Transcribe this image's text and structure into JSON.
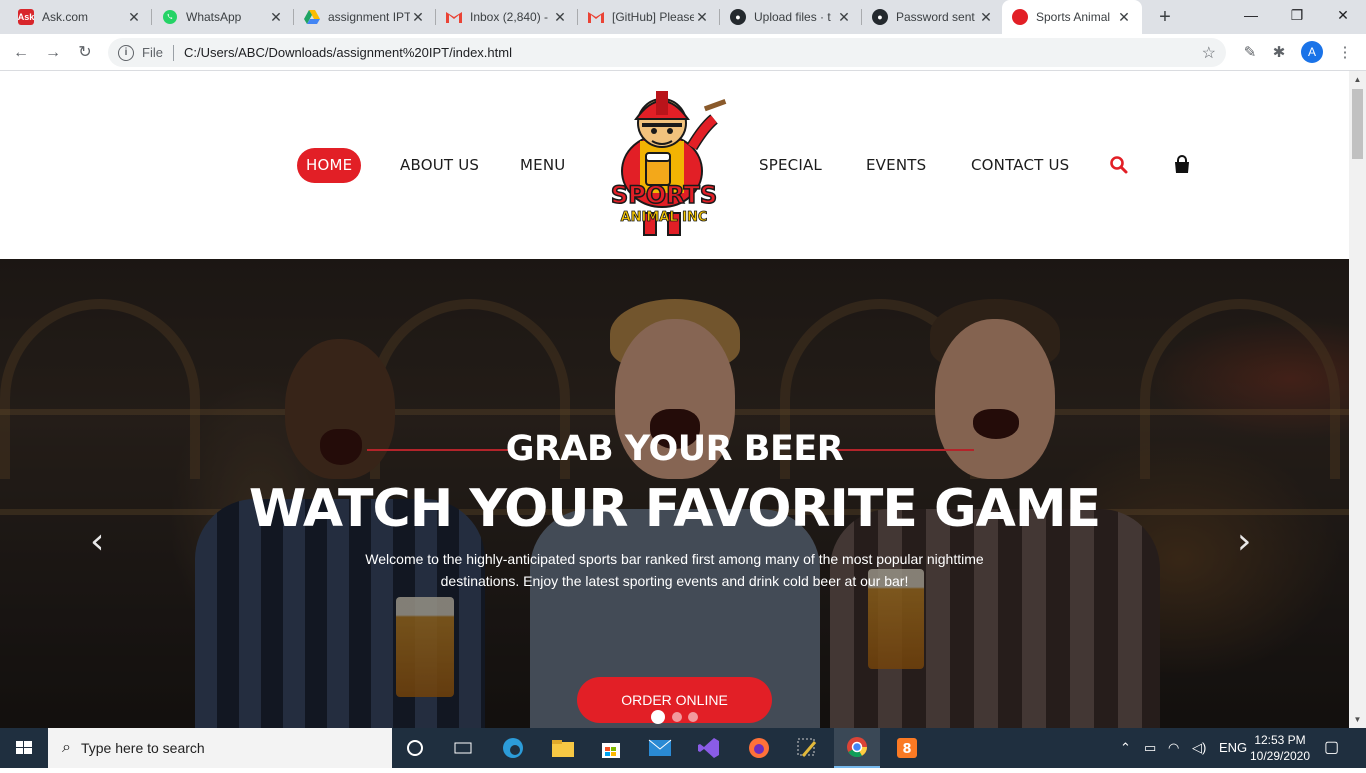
{
  "browser": {
    "tabs": [
      {
        "title": "Ask.com",
        "favicon": "ask-icon",
        "color": "#d8262b",
        "active": false
      },
      {
        "title": "WhatsApp",
        "favicon": "whatsapp-icon",
        "color": "#25d366",
        "active": false
      },
      {
        "title": "assignment IPT",
        "favicon": "drive-icon",
        "color": "#fbbc04",
        "active": false
      },
      {
        "title": "Inbox (2,840) -",
        "favicon": "gmail-icon",
        "color": "#ea4335",
        "active": false
      },
      {
        "title": "[GitHub] Please",
        "favicon": "gmail-icon",
        "color": "#ea4335",
        "active": false
      },
      {
        "title": "Upload files · t",
        "favicon": "github-icon",
        "color": "#24292e",
        "active": false
      },
      {
        "title": "Password sent",
        "favicon": "github-icon",
        "color": "#24292e",
        "active": false
      },
      {
        "title": "Sports Animal",
        "favicon": "sports-animal-icon",
        "color": "#e21f26",
        "active": true
      }
    ],
    "address": {
      "scheme": "File",
      "url": "C:/Users/ABC/Downloads/assignment%20IPT/index.html"
    },
    "profile_initial": "A"
  },
  "site": {
    "nav_left": [
      "HOME",
      "ABOUT US",
      "MENU"
    ],
    "nav_right": [
      "SPECIAL",
      "EVENTS",
      "CONTACT US"
    ],
    "logo": {
      "line1": "SPORTS",
      "line2": "ANIMAL INC"
    },
    "accent_color": "#e21f26",
    "hero": {
      "subtitle": "GRAB YOUR BEER",
      "title": "WATCH YOUR FAVORITE GAME",
      "description_line1": "Welcome to the highly-anticipated sports bar ranked first among many of the most popular nighttime",
      "description_line2": "destinations. Enjoy the latest sporting events and drink cold beer at our bar!",
      "cta": "ORDER ONLINE",
      "slides": 3,
      "active_slide": 1
    }
  },
  "taskbar": {
    "search_placeholder": "Type here to search",
    "language": "ENG",
    "time": "12:53 PM",
    "date": "10/29/2020"
  }
}
